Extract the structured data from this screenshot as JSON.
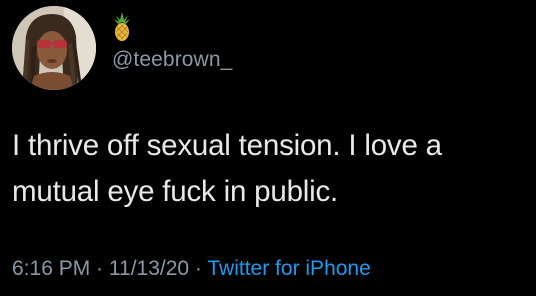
{
  "author": {
    "avatar_icon": "profile-photo",
    "emoji_icon": "pineapple-icon",
    "handle": "@teebrown_"
  },
  "tweet": {
    "text_line1": "I thrive off sexual tension. I love a",
    "text_line2": "mutual eye fuck in public."
  },
  "meta": {
    "time": "6:16 PM",
    "separator1": " · ",
    "date": "11/13/20",
    "separator2": " · ",
    "source": "Twitter for iPhone"
  },
  "colors": {
    "background": "#000000",
    "text": "#e7e9ea",
    "muted": "#8b98a5",
    "link": "#1d9bf0"
  }
}
